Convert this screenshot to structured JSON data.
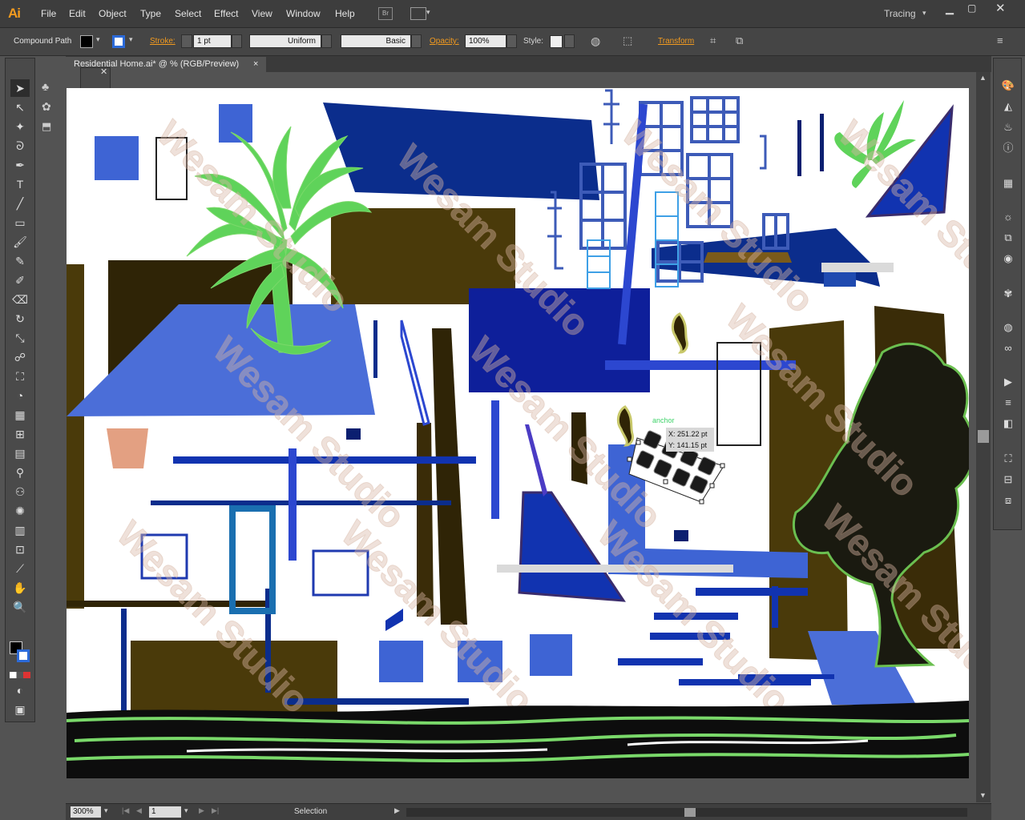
{
  "app": {
    "logo": "Ai",
    "workspace": "Tracing",
    "bridge": "Br"
  },
  "menu": [
    "File",
    "Edit",
    "Object",
    "Type",
    "Select",
    "Effect",
    "View",
    "Window",
    "Help"
  ],
  "control": {
    "selection_type": "Compound Path",
    "stroke_label": "Stroke:",
    "stroke_weight": "1 pt",
    "profile": "Uniform",
    "brush": "Basic",
    "opacity_label": "Opacity:",
    "opacity": "100%",
    "style_label": "Style:",
    "transform_label": "Transform"
  },
  "document": {
    "tab_title": "Residential Home.ai* @ % (RGB/Preview)",
    "close": "×"
  },
  "tooltip": {
    "anchor": "anchor",
    "x": "X: 251.22 pt",
    "y": "Y: 141.15 pt"
  },
  "watermark": "Wesam Studio",
  "status": {
    "zoom": "300%",
    "page": "1",
    "tool": "Selection"
  },
  "colors": {
    "accent": "#f39b1f",
    "brown": "#4a3a0a",
    "blue": "#0b2d8c",
    "mid_blue": "#3e64d4",
    "leaf": "#5fd35a"
  },
  "tools": [
    "selection-tool",
    "direct-selection-tool",
    "magic-wand-tool",
    "lasso-tool",
    "pen-tool",
    "type-tool",
    "line-tool",
    "rectangle-tool",
    "paintbrush-tool",
    "pencil-tool",
    "blob-brush-tool",
    "eraser-tool",
    "rotate-tool",
    "scale-tool",
    "warp-tool",
    "free-transform-tool",
    "shape-builder-tool",
    "perspective-grid-tool",
    "mesh-tool",
    "gradient-tool",
    "eyedropper-tool",
    "blend-tool",
    "symbol-sprayer-tool",
    "column-graph-tool",
    "artboard-tool",
    "slice-tool",
    "hand-tool",
    "zoom-tool"
  ]
}
